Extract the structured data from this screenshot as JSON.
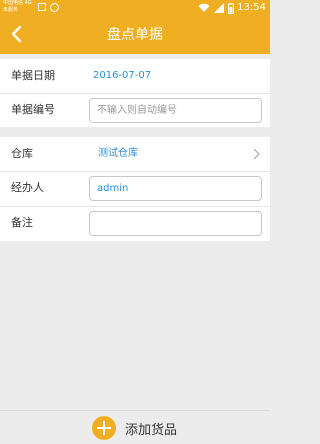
{
  "status_bar": {
    "carrier_line1": "中国电信 4G",
    "carrier_line2": "未服务",
    "time": "13:54",
    "icons": [
      "image-icon",
      "smiley-icon",
      "wifi-icon",
      "signal-icon",
      "battery-icon"
    ]
  },
  "header": {
    "title": "盘点单据",
    "back_icon": "chevron-left-icon"
  },
  "form": {
    "date_label": "单据日期",
    "date_value": "2016-07-07",
    "number_label": "单据编号",
    "number_placeholder": "不输入则自动编号",
    "warehouse_label": "仓库",
    "warehouse_value": "测试仓库",
    "handler_label": "经办人",
    "handler_value": "admin",
    "remark_label": "备注",
    "remark_value": ""
  },
  "footer": {
    "add_label": "添加货品",
    "add_icon": "plus-circle-icon"
  },
  "colors": {
    "accent": "#f0ae23",
    "link": "#2a8fd8",
    "background": "#ececec"
  }
}
